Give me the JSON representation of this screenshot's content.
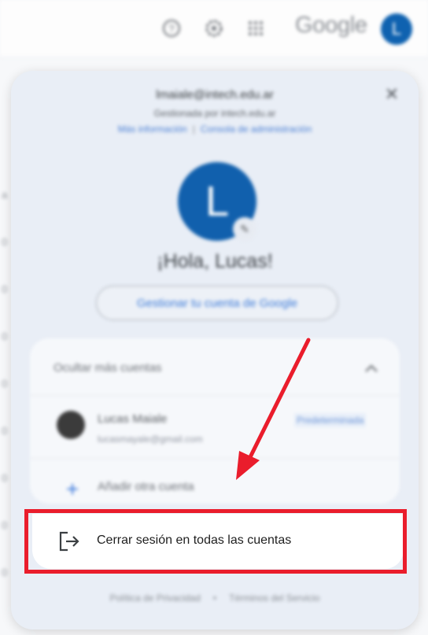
{
  "header": {
    "logo_text": "Google",
    "avatar_initial": "L",
    "icons": [
      "help-icon",
      "settings-icon",
      "apps-icon"
    ]
  },
  "left_list_numbers": [
    "a",
    "0",
    "0",
    "0",
    "0",
    "0",
    "0",
    "0",
    "0"
  ],
  "panel": {
    "email": "lmaiale@intech.edu.ar",
    "managed_by": "Gestionada por intech.edu.ar",
    "more_info": "Más información",
    "admin_console": "Consola de administración",
    "greeting": "¡Hola, Lucas!",
    "avatar_initial": "L",
    "manage_account": "Gestionar tu cuenta de Google"
  },
  "accounts": {
    "hide_label": "Ocultar más cuentas",
    "items": [
      {
        "name": "Lucas Maiale",
        "email": "lucasmayale@gmail.com",
        "badge": "Predeterminada"
      }
    ],
    "add_account": "Añadir otra cuenta"
  },
  "signout": {
    "label": "Cerrar sesión en todas las cuentas"
  },
  "footer": {
    "privacy": "Política de Privacidad",
    "separator": "•",
    "terms": "Términos del Servicio"
  },
  "colors": {
    "highlight": "#ea1d2c",
    "avatar": "#1160ad",
    "link": "#4a7fd4"
  }
}
